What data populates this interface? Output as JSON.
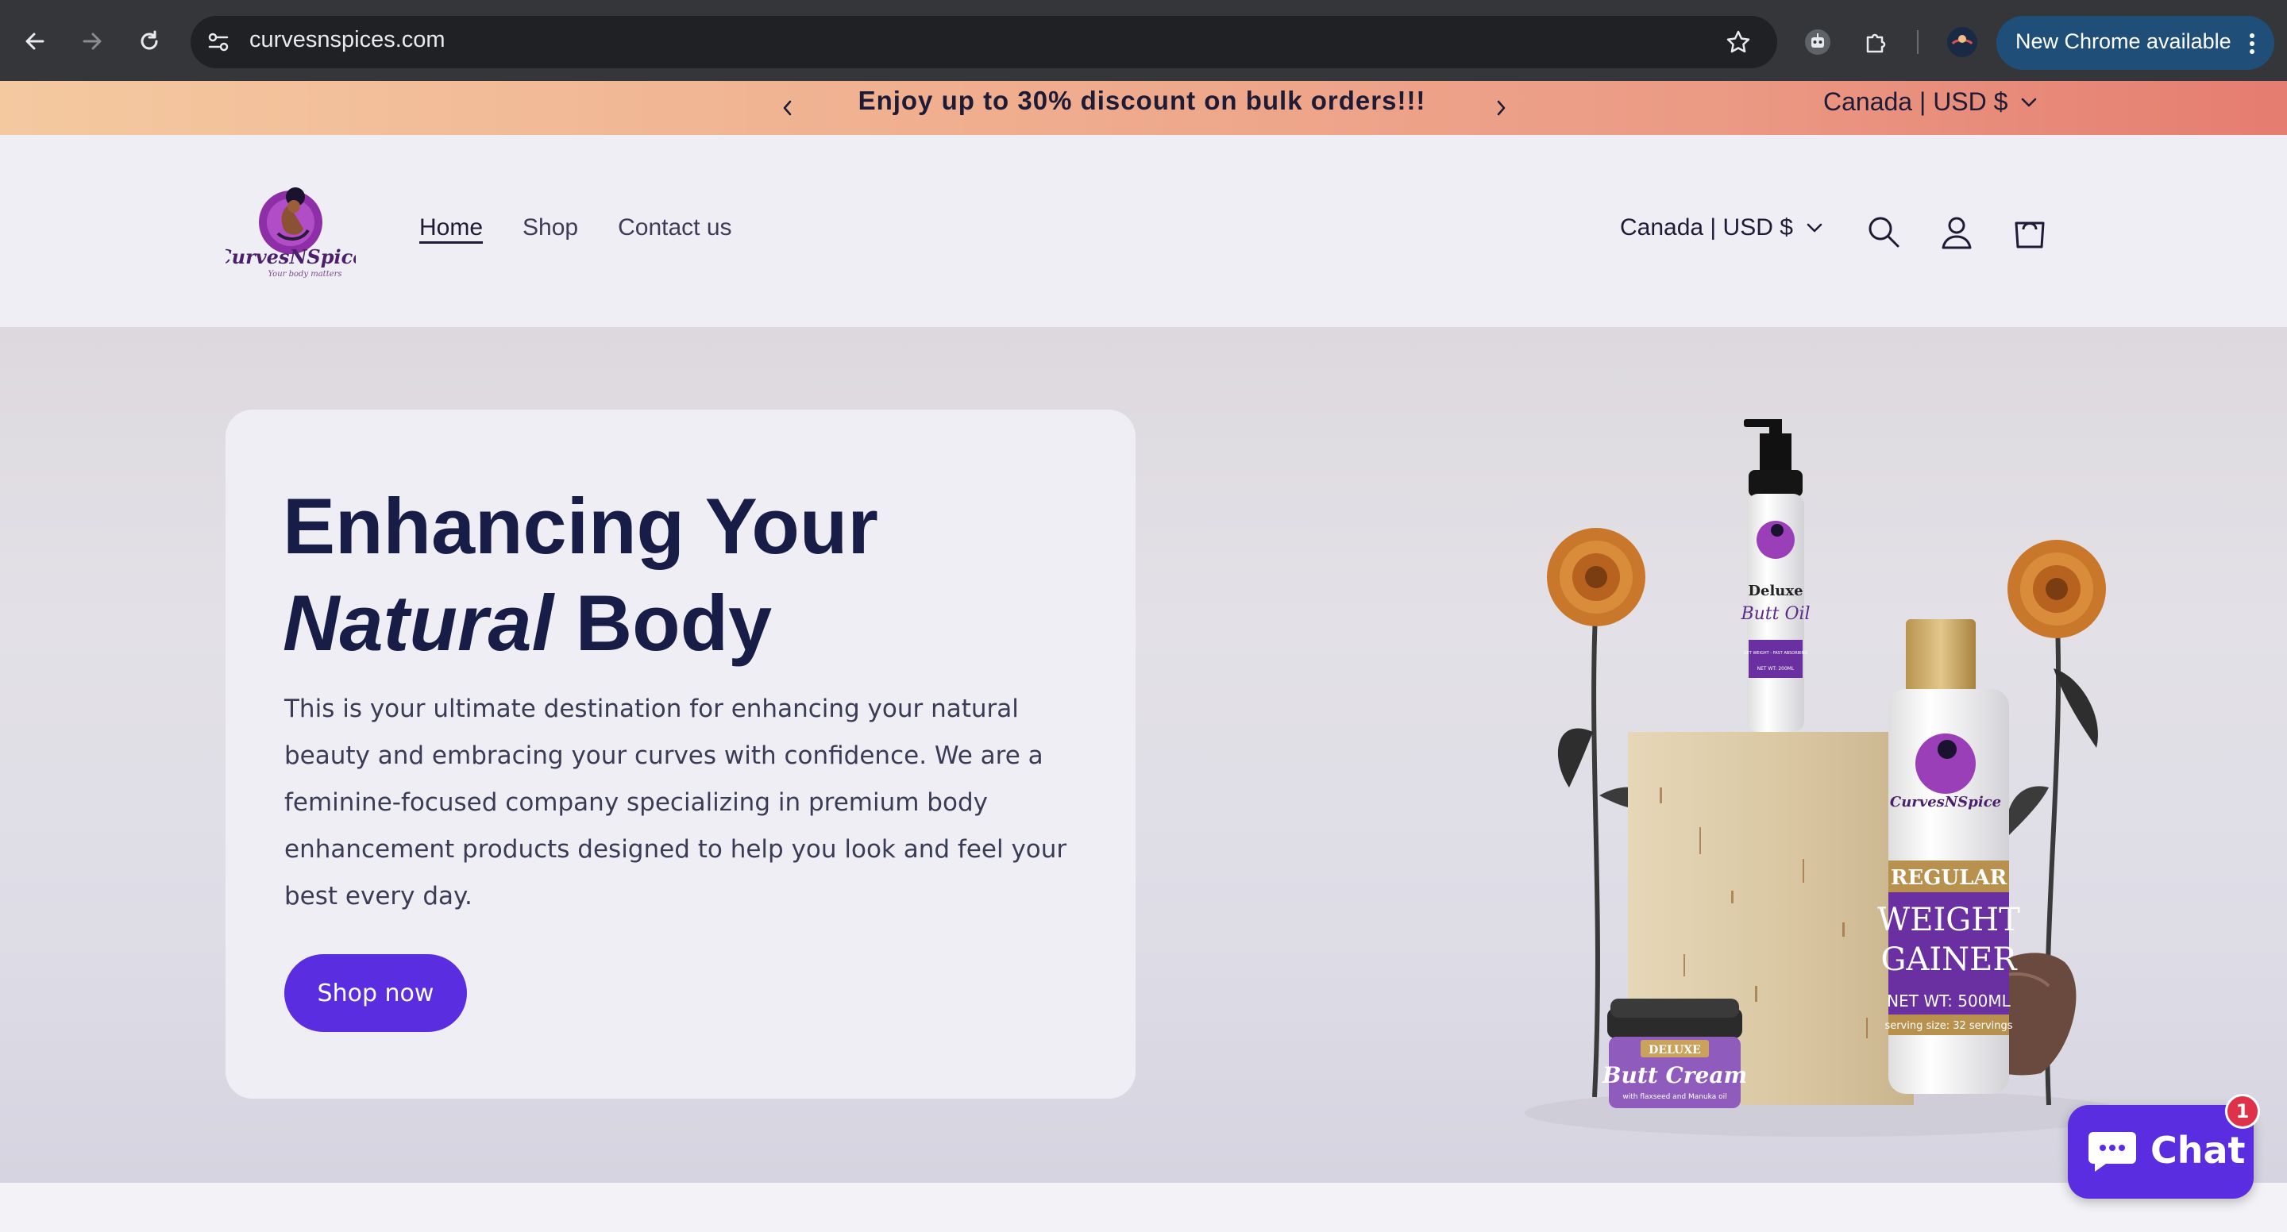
{
  "browser": {
    "url": "curvesnspices.com",
    "update_label": "New Chrome available"
  },
  "announcement": {
    "message": "Enjoy up to 30% discount on bulk orders!!!",
    "locale": "Canada | USD $"
  },
  "header": {
    "logo_text": "CurvesNSpice",
    "logo_tagline": "Your body matters",
    "nav": [
      "Home",
      "Shop",
      "Contact us"
    ],
    "locale": "Canada | USD $"
  },
  "hero": {
    "title_line1": "Enhancing Your",
    "title_italic": "Natural",
    "title_rest": " Body",
    "body": "This is your ultimate destination for enhancing your natural beauty and embracing your curves with confidence. We are a feminine-focused company specializing in premium body enhancement products designed to help you look and feel your best every day.",
    "cta": "Shop now",
    "products": {
      "oil_line1": "Deluxe",
      "oil_line2": "Butt Oil",
      "oil_small1": "GET WEIGHT - FAST ABSORBING",
      "oil_small2": "NET WT: 200ML",
      "gainer_brand": "CurvesNSpice",
      "gainer_band": "REGULAR",
      "gainer_line1": "WEIGHT",
      "gainer_line2": "GAINER",
      "gainer_net": "NET WT: 500ML",
      "gainer_serving": "serving size: 32 servings",
      "cream_band": "DELUXE",
      "cream_name": "Butt Cream",
      "cream_small": "with flaxseed and Manuka oil"
    }
  },
  "chat": {
    "label": "Chat",
    "badge": "1"
  },
  "colors": {
    "accent": "#5a2ee0",
    "heading": "#171d46",
    "badge": "#e0314b"
  }
}
